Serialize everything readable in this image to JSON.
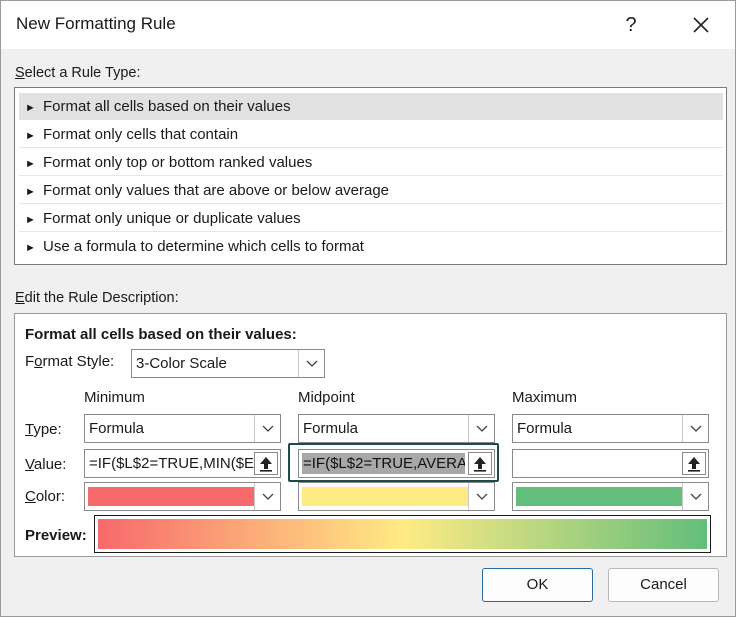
{
  "dialog": {
    "title": "New Formatting Rule",
    "help_glyph": "?",
    "close_glyph": "✕"
  },
  "rule_type": {
    "label_accel": "S",
    "label_rest": "elect a Rule Type:",
    "items": [
      {
        "label": "Format all cells based on their values",
        "selected": true
      },
      {
        "label": "Format only cells that contain",
        "selected": false
      },
      {
        "label": "Format only top or bottom ranked values",
        "selected": false
      },
      {
        "label": "Format only values that are above or below average",
        "selected": false
      },
      {
        "label": "Format only unique or duplicate values",
        "selected": false
      },
      {
        "label": "Use a formula to determine which cells to format",
        "selected": false
      }
    ],
    "bullet": "►"
  },
  "description": {
    "label_accel": "E",
    "label_rest": "dit the Rule Description:",
    "heading": "Format all cells based on their values:",
    "format_style": {
      "label_pre": "F",
      "label_accel": "o",
      "label_post": "rmat Style:",
      "value": "3-Color Scale"
    },
    "columns": {
      "minimum": "Minimum",
      "midpoint": "Midpoint",
      "maximum": "Maximum"
    },
    "type_label_accel": "T",
    "type_label_rest": "ype:",
    "value_label_accel": "V",
    "value_label_rest": "alue:",
    "color_label_accel": "C",
    "color_label_rest": "olor:",
    "minimum": {
      "type": "Formula",
      "value": "=IF($L$2=TRUE,MIN($E",
      "color": "#f8696b"
    },
    "midpoint": {
      "type": "Formula",
      "value": "=IF($L$2=TRUE,AVERAG",
      "color": "#ffeb84"
    },
    "maximum": {
      "type": "Formula",
      "value": "",
      "color": "#63be7b"
    },
    "preview_label": "Preview:"
  },
  "buttons": {
    "ok": "OK",
    "cancel": "Cancel"
  },
  "icons": {
    "dropdown": "chevron-down-icon",
    "ref_select": "collapse-dialog-icon"
  }
}
